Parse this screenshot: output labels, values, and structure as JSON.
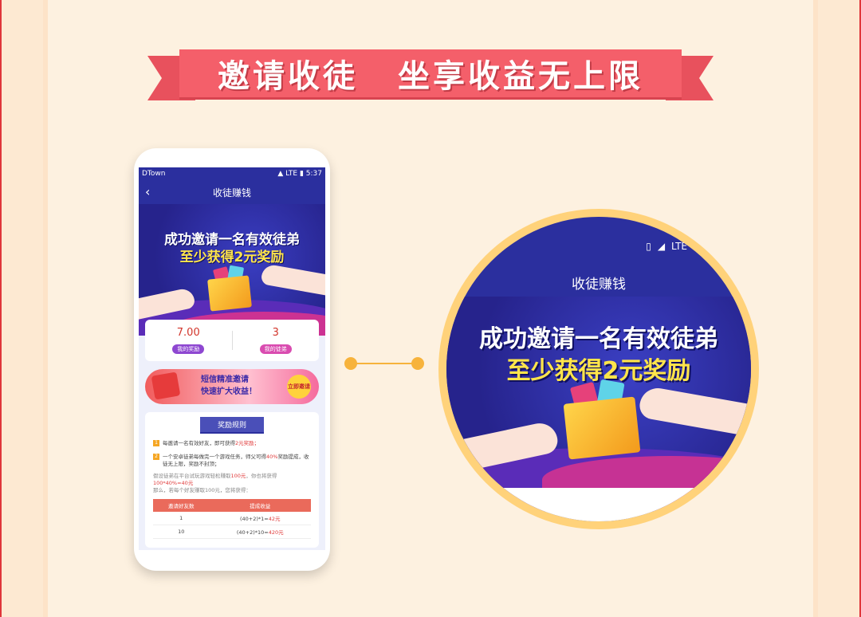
{
  "banner": {
    "left": "邀请收徒",
    "right": "坐享收益无上限"
  },
  "phone": {
    "status": {
      "carrier": "DTown",
      "network": "LTE",
      "time": "5:37"
    },
    "nav": {
      "title": "收徒赚钱",
      "back": "‹"
    },
    "hero": {
      "line1": "成功邀请一名有效徒弟",
      "line2": "至少获得2元奖励"
    },
    "stats": [
      {
        "value": "7.00",
        "label": "我的奖励"
      },
      {
        "value": "3",
        "label": "我的徒弟"
      }
    ],
    "promo": {
      "line1": "短信精准邀请",
      "line2": "快速扩大收益！",
      "button": "立即邀请"
    },
    "rules": {
      "title": "奖励规则",
      "items": [
        {
          "num": "1",
          "text": "每邀请一名有效好友，即可获得",
          "highlight": "2元奖励；"
        },
        {
          "num": "2",
          "text": "一个安卓徒弟每做完一个游戏任务，师父可得",
          "highlight": "40%",
          "text2": "奖励提成，收徒无上限，奖励不封顶；"
        }
      ],
      "note1": "假设徒弟在平台试玩游戏轻松赚取",
      "note1_red": "100元",
      "note1_b": "，你也将获得",
      "note2_red": "100*40%=40元",
      "note3": "那么，若每个好友赚取100元，您将获得：",
      "table": {
        "headers": [
          "邀请好友数",
          "提成收益"
        ],
        "rows": [
          {
            "count": "1",
            "formula": "(40+2)*1=",
            "value": "42元"
          },
          {
            "count": "10",
            "formula": "(40+2)*10=",
            "value": "420元"
          }
        ]
      }
    }
  },
  "zoom": {
    "network": "LTE",
    "title": "收徒赚钱",
    "line1": "成功邀请一名有效徒弟",
    "line2": "至少获得2元奖励"
  },
  "colors": {
    "accent": "#f45f6a",
    "brand": "#2b2f9e",
    "highlight": "#ffe54a",
    "connector": "#f7b33c"
  }
}
